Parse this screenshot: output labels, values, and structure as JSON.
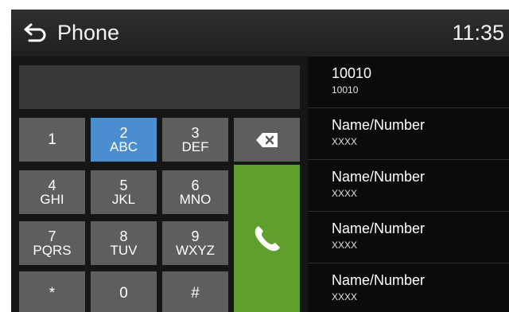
{
  "header": {
    "title": "Phone",
    "time": "11:35"
  },
  "dialer": {
    "display_value": "",
    "keys": [
      {
        "digit": "1",
        "letters": ""
      },
      {
        "digit": "2",
        "letters": "ABC"
      },
      {
        "digit": "3",
        "letters": "DEF"
      },
      {
        "digit": "4",
        "letters": "GHI"
      },
      {
        "digit": "5",
        "letters": "JKL"
      },
      {
        "digit": "6",
        "letters": "MNO"
      },
      {
        "digit": "7",
        "letters": "PQRS"
      },
      {
        "digit": "8",
        "letters": "TUV"
      },
      {
        "digit": "9",
        "letters": "WXYZ"
      },
      {
        "digit": "*",
        "letters": ""
      },
      {
        "digit": "0",
        "letters": ""
      },
      {
        "digit": "#",
        "letters": ""
      }
    ],
    "active_key": "2",
    "backspace_icon": "backspace-icon",
    "call_icon": "phone-handset-icon",
    "colors": {
      "key": "#5e5e5e",
      "active_key": "#4a8ed0",
      "call": "#5ea02b"
    }
  },
  "contacts": [
    {
      "name": "10010",
      "number": "10010"
    },
    {
      "name": "Name/Number",
      "number": "XXXX"
    },
    {
      "name": "Name/Number",
      "number": "XXXX"
    },
    {
      "name": "Name/Number",
      "number": "XXXX"
    },
    {
      "name": "Name/Number",
      "number": "XXXX"
    }
  ]
}
